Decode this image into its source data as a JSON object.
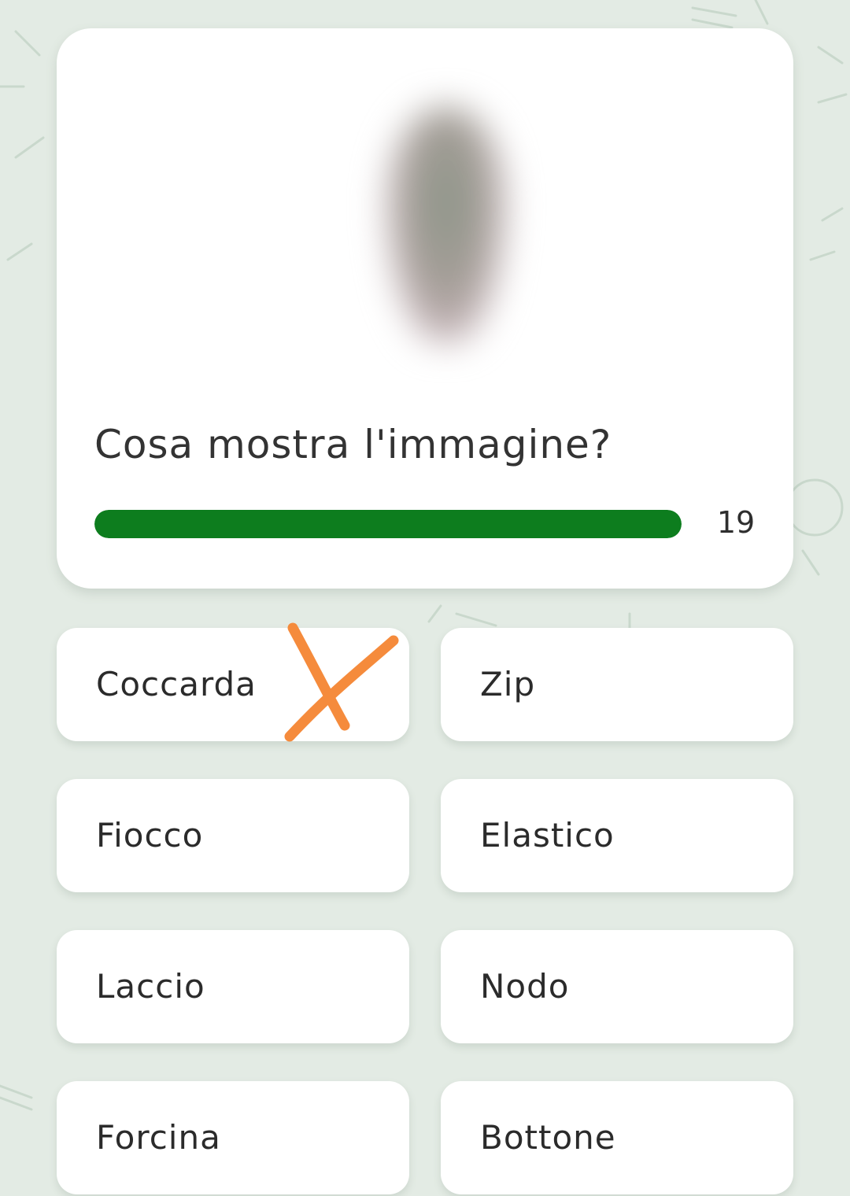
{
  "quiz": {
    "question": "Cosa mostra l'immagine?",
    "timer": {
      "remaining": "19",
      "progress_fraction": 1.0,
      "color": "#0d7d1e"
    },
    "answers": [
      {
        "label": "Coccarda"
      },
      {
        "label": "Zip"
      },
      {
        "label": "Fiocco"
      },
      {
        "label": "Elastico"
      },
      {
        "label": "Laccio"
      },
      {
        "label": "Nodo"
      },
      {
        "label": "Forcina"
      },
      {
        "label": "Bottone"
      }
    ]
  },
  "annotation": {
    "icon": "x-mark-icon",
    "color": "#f58b3c"
  },
  "colors": {
    "background": "#e3ebe4",
    "card": "#ffffff",
    "text": "#2b2b2b"
  }
}
